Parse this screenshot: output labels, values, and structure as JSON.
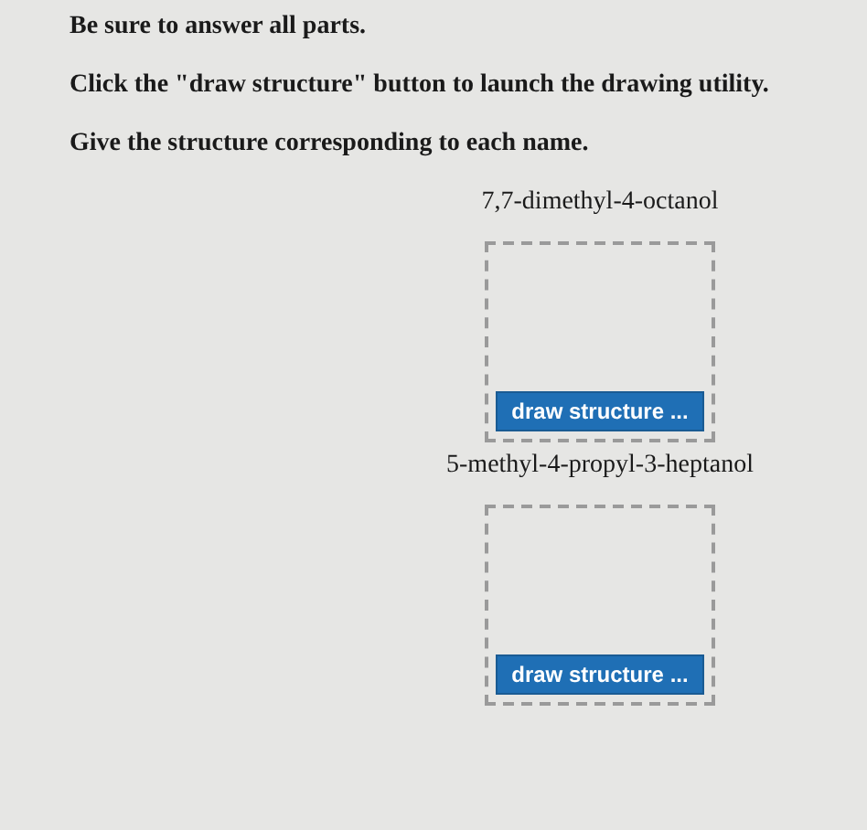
{
  "instructions": [
    "Be sure to answer all parts.",
    "Click the \"draw structure\" button to launch the drawing utility.",
    "Give the structure corresponding to each name."
  ],
  "questions": [
    {
      "name": "7,7-dimethyl-4-octanol",
      "button": "draw structure ..."
    },
    {
      "name": "5-methyl-4-propyl-3-heptanol",
      "button": "draw structure ..."
    }
  ]
}
